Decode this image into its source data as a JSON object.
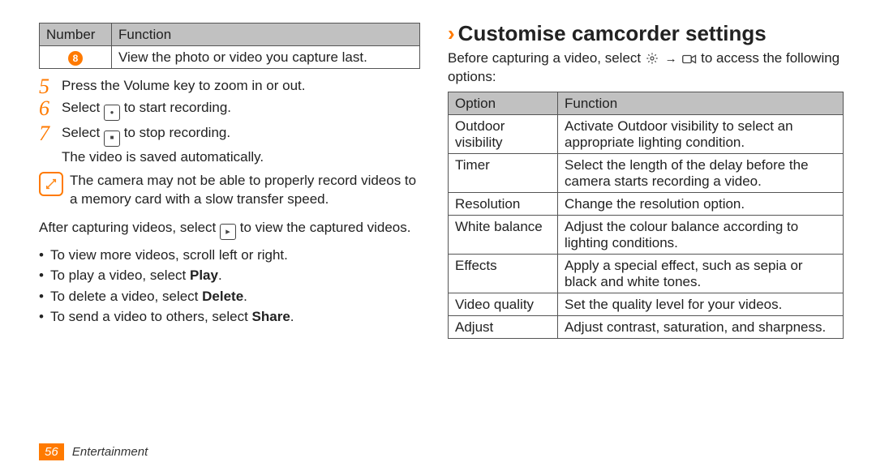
{
  "page_number": "56",
  "footer_section": "Entertainment",
  "left": {
    "table": {
      "headers": [
        "Number",
        "Function"
      ],
      "row": {
        "num_glyph": "8",
        "func": "View the photo or video you capture last."
      }
    },
    "steps": {
      "s5_num": "5",
      "s5": "Press the Volume key to zoom in or out.",
      "s6_num": "6",
      "s6a": "Select",
      "s6b": "to start recording.",
      "s7_num": "7",
      "s7a": "Select",
      "s7b": "to stop recording.",
      "s7_sub": "The video is saved automatically."
    },
    "note": "The camera may not be able to properly record videos to a memory card with a slow transfer speed.",
    "after_a": "After capturing videos, select",
    "after_b": "to view the captured videos.",
    "bullets": {
      "b1": "To view more videos, scroll left or right.",
      "b2a": "To play a video, select ",
      "b2b": "Play",
      "b2c": ".",
      "b3a": "To delete a video, select ",
      "b3b": "Delete",
      "b3c": ".",
      "b4a": "To send a video to others, select ",
      "b4b": "Share",
      "b4c": "."
    }
  },
  "right": {
    "heading": "Customise camcorder settings",
    "intro_a": "Before capturing a video, select",
    "intro_b": "to access the following options:",
    "table": {
      "headers": [
        "Option",
        "Function"
      ],
      "rows": [
        {
          "opt": "Outdoor visibility",
          "func": "Activate Outdoor visibility to select an appropriate lighting condition."
        },
        {
          "opt": "Timer",
          "func": "Select the length of the delay before the camera starts recording a video."
        },
        {
          "opt": "Resolution",
          "func": "Change the resolution option."
        },
        {
          "opt": "White balance",
          "func": "Adjust the colour balance according to lighting conditions."
        },
        {
          "opt": "Effects",
          "func": "Apply a special effect, such as sepia or black and white tones."
        },
        {
          "opt": "Video quality",
          "func": "Set the quality level for your videos."
        },
        {
          "opt": "Adjust",
          "func": "Adjust contrast, saturation, and sharpness."
        }
      ]
    }
  }
}
